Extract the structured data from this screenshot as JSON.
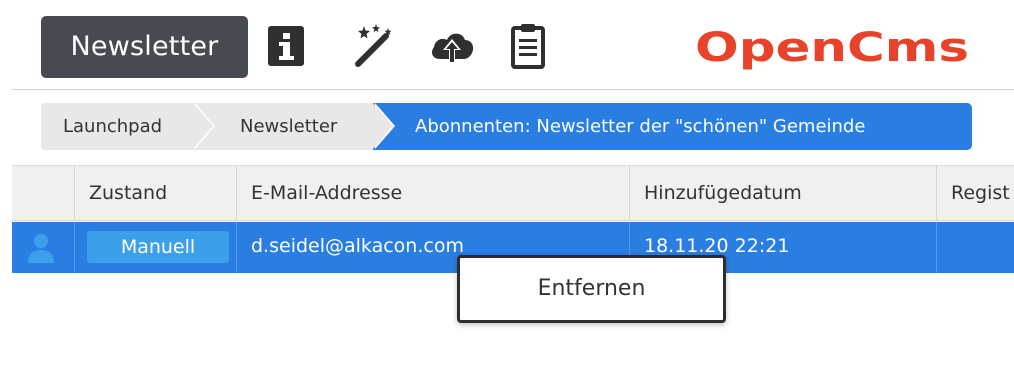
{
  "toolbar": {
    "app_title": "Newsletter",
    "icons": [
      "info-icon",
      "magic-wand-icon",
      "cloud-upload-icon",
      "clipboard-icon"
    ]
  },
  "logo": {
    "text": "OpenCms",
    "color": "#e8422b"
  },
  "breadcrumb": {
    "items": [
      {
        "label": "Launchpad"
      },
      {
        "label": "Newsletter"
      },
      {
        "label": "Abonnenten: Newsletter der \"schönen\" Gemeinde"
      }
    ]
  },
  "table": {
    "columns": [
      "",
      "Zustand",
      "E-Mail-Addresse",
      "Hinzufügedatum",
      "Regist"
    ],
    "rows": [
      {
        "icon": "user-icon",
        "status": "Manuell",
        "email": "d.seidel@alkacon.com",
        "date": "18.11.20 22:21",
        "registered": ""
      }
    ]
  },
  "context_menu": {
    "items": [
      "Entfernen"
    ]
  },
  "colors": {
    "accent": "#2a7de1",
    "badge": "#3b9fea",
    "toolbar_title_bg": "#474a50"
  }
}
